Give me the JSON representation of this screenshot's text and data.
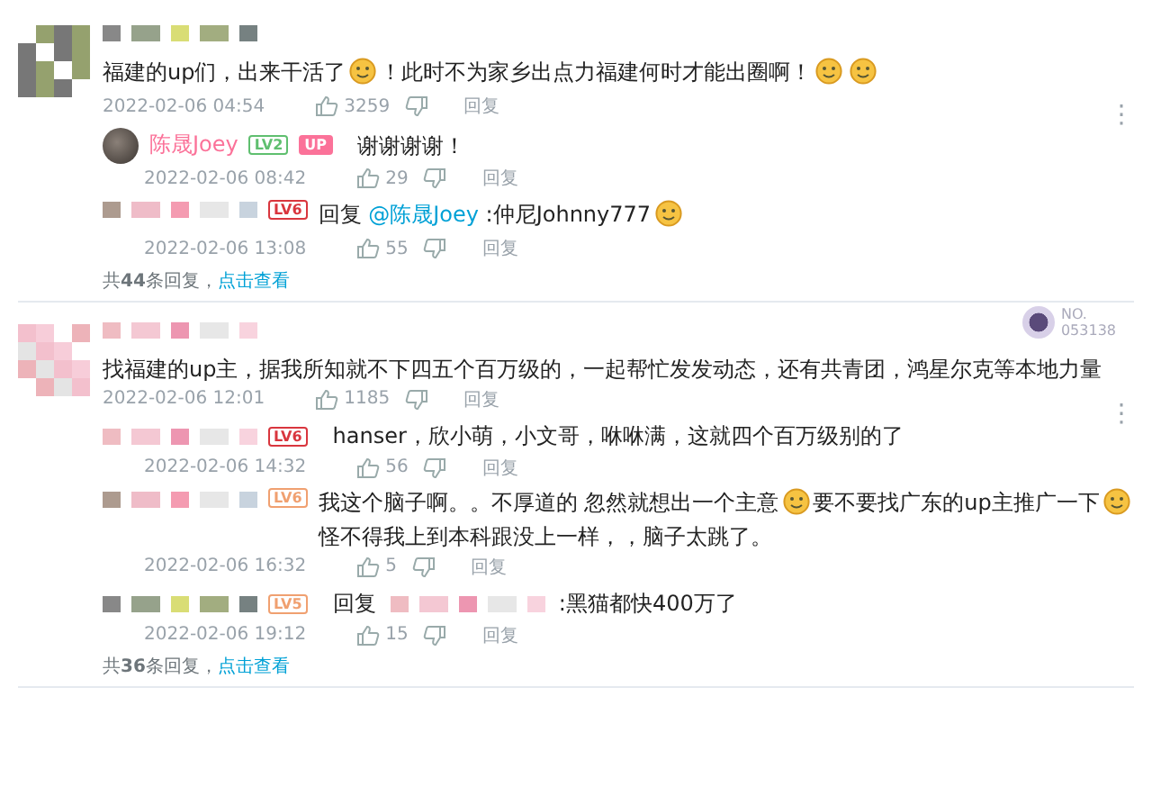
{
  "comments": [
    {
      "author": {
        "kind": "pixelated"
      },
      "content": [
        {
          "kind": "text",
          "text": "福建的up们，出来干活了"
        },
        {
          "kind": "emoji"
        },
        {
          "kind": "text",
          "text": "！此时不为家乡出点力福建何时才能出圈啊！"
        },
        {
          "kind": "emoji"
        },
        {
          "kind": "emoji"
        }
      ],
      "date": "2022-02-06 04:54",
      "likes": "3259",
      "reply_label": "回复",
      "more": "⋮",
      "replies": [
        {
          "author": {
            "kind": "named",
            "name": "陈晟Joey"
          },
          "badges": [
            {
              "text": "LV2",
              "color": "#5fbf6f"
            },
            {
              "text": "UP",
              "color": "#fb7299"
            }
          ],
          "content": [
            {
              "kind": "text",
              "text": "谢谢谢谢！"
            }
          ],
          "date": "2022-02-06 08:42",
          "likes": "29",
          "reply_label": "回复"
        },
        {
          "author": {
            "kind": "pixelated"
          },
          "badges": [
            {
              "text": "LV6",
              "color": "#d9363e"
            }
          ],
          "content": [
            {
              "kind": "text",
              "text": "回复 "
            },
            {
              "kind": "mention",
              "text": "@陈晟Joey"
            },
            {
              "kind": "text",
              "text": " :仲尼Johnny777"
            },
            {
              "kind": "emoji"
            }
          ],
          "date": "2022-02-06 13:08",
          "likes": "55",
          "reply_label": "回复"
        }
      ],
      "summary": "共**44**条回复，",
      "view_link": "点击查看"
    },
    {
      "author": {
        "kind": "pixelated"
      },
      "fan_card": {
        "label": "NO.",
        "number": "053138"
      },
      "content": [
        {
          "kind": "text",
          "text": "找福建的up主，据我所知就不下四五个百万级的，一起帮忙发发动态，还有共青团，鸿星尔克等本地力量"
        }
      ],
      "date": "2022-02-06 12:01",
      "likes": "1185",
      "reply_label": "回复",
      "more": "⋮",
      "replies": [
        {
          "author": {
            "kind": "pixelated"
          },
          "badges": [
            {
              "text": "LV6",
              "color": "#d9363e"
            }
          ],
          "content": [
            {
              "kind": "text",
              "text": "hanser，欣小萌，小文哥，咻咻满，这就四个百万级别的了"
            }
          ],
          "date": "2022-02-06 14:32",
          "likes": "56",
          "reply_label": "回复"
        },
        {
          "author": {
            "kind": "pixelated"
          },
          "badges": [
            {
              "text": "LV6",
              "color": "#f0a070"
            }
          ],
          "content": [
            {
              "kind": "text",
              "text": "我这个脑子啊。。不厚道的 忽然就想出一个主意"
            },
            {
              "kind": "emoji"
            },
            {
              "kind": "text",
              "text": "要不要找广东的up主推广一下"
            },
            {
              "kind": "emoji"
            },
            {
              "kind": "text",
              "text": "怪不得我上到本科跟没上一样，，脑子太跳了。"
            }
          ],
          "date": "2022-02-06 16:32",
          "likes": "5",
          "reply_label": "回复"
        },
        {
          "author": {
            "kind": "pixelated"
          },
          "badges": [
            {
              "text": "LV5",
              "color": "#f0a070"
            }
          ],
          "content": [
            {
              "kind": "text",
              "text": "回复 "
            },
            {
              "kind": "hidden"
            },
            {
              "kind": "text",
              "text": " :黑猫都快400万了"
            }
          ],
          "date": "2022-02-06 19:12",
          "likes": "15",
          "reply_label": "回复"
        }
      ],
      "summary": "共**36**条回复，",
      "view_link": "点击查看"
    }
  ]
}
